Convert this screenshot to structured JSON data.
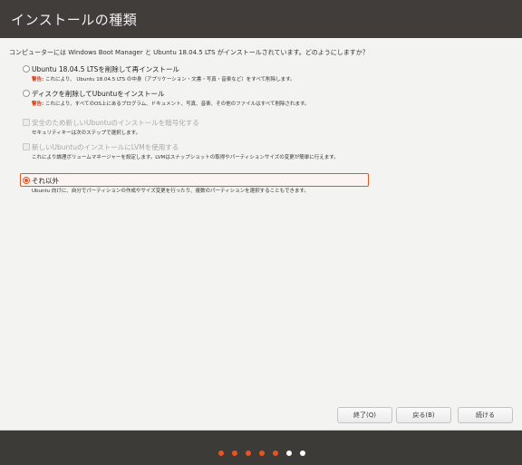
{
  "window": {
    "title": "インストールの種類"
  },
  "question": "コンピューターには Windows Boot Manager と Ubuntu 18.04.5 LTS がインストールされています。どのようにしますか？",
  "options": [
    {
      "label": "Ubuntu 18.04.5 LTSを削除して再インストール",
      "warning_prefix": "警告:",
      "description": " これにより、 Ubuntu 18.04.5 LTS の中身（アプリケーション・文書・写真・音楽など）をすべて削除します。",
      "state": "unchecked"
    },
    {
      "label": "ディスクを削除してUbuntuをインストール",
      "warning_prefix": "警告:",
      "description": " これにより、すべてのOS上にあるプログラム、ドキュメント、写真、音楽、その他のファイルはすべて削除されます。",
      "state": "unchecked"
    },
    {
      "label": "安全のため新しいUbuntuのインストールを暗号化する",
      "description": "セキュリティキーは次のステップで選択します。",
      "state": "disabled"
    },
    {
      "label": "新しいUbuntuのインストールにLVMを使用する",
      "description": "これにより論理ボリュームマネージャーを設定します。LVMはスナップショットの取得やパーティションサイズの変更が簡単に行えます。",
      "state": "disabled"
    },
    {
      "label": "それ以外",
      "description": "Ubuntu 向けに、自分でパーティションの作成やサイズ変更を行ったり、複数のパーティションを選択することもできます。",
      "state": "selected"
    }
  ],
  "buttons": {
    "quit": "終了(Q)",
    "back": "戻る(B)",
    "continue": "続ける"
  },
  "progress": {
    "total_steps": 7,
    "completed_steps": 5,
    "colors": {
      "done": "#e95420",
      "pending": "#ffffff"
    }
  }
}
